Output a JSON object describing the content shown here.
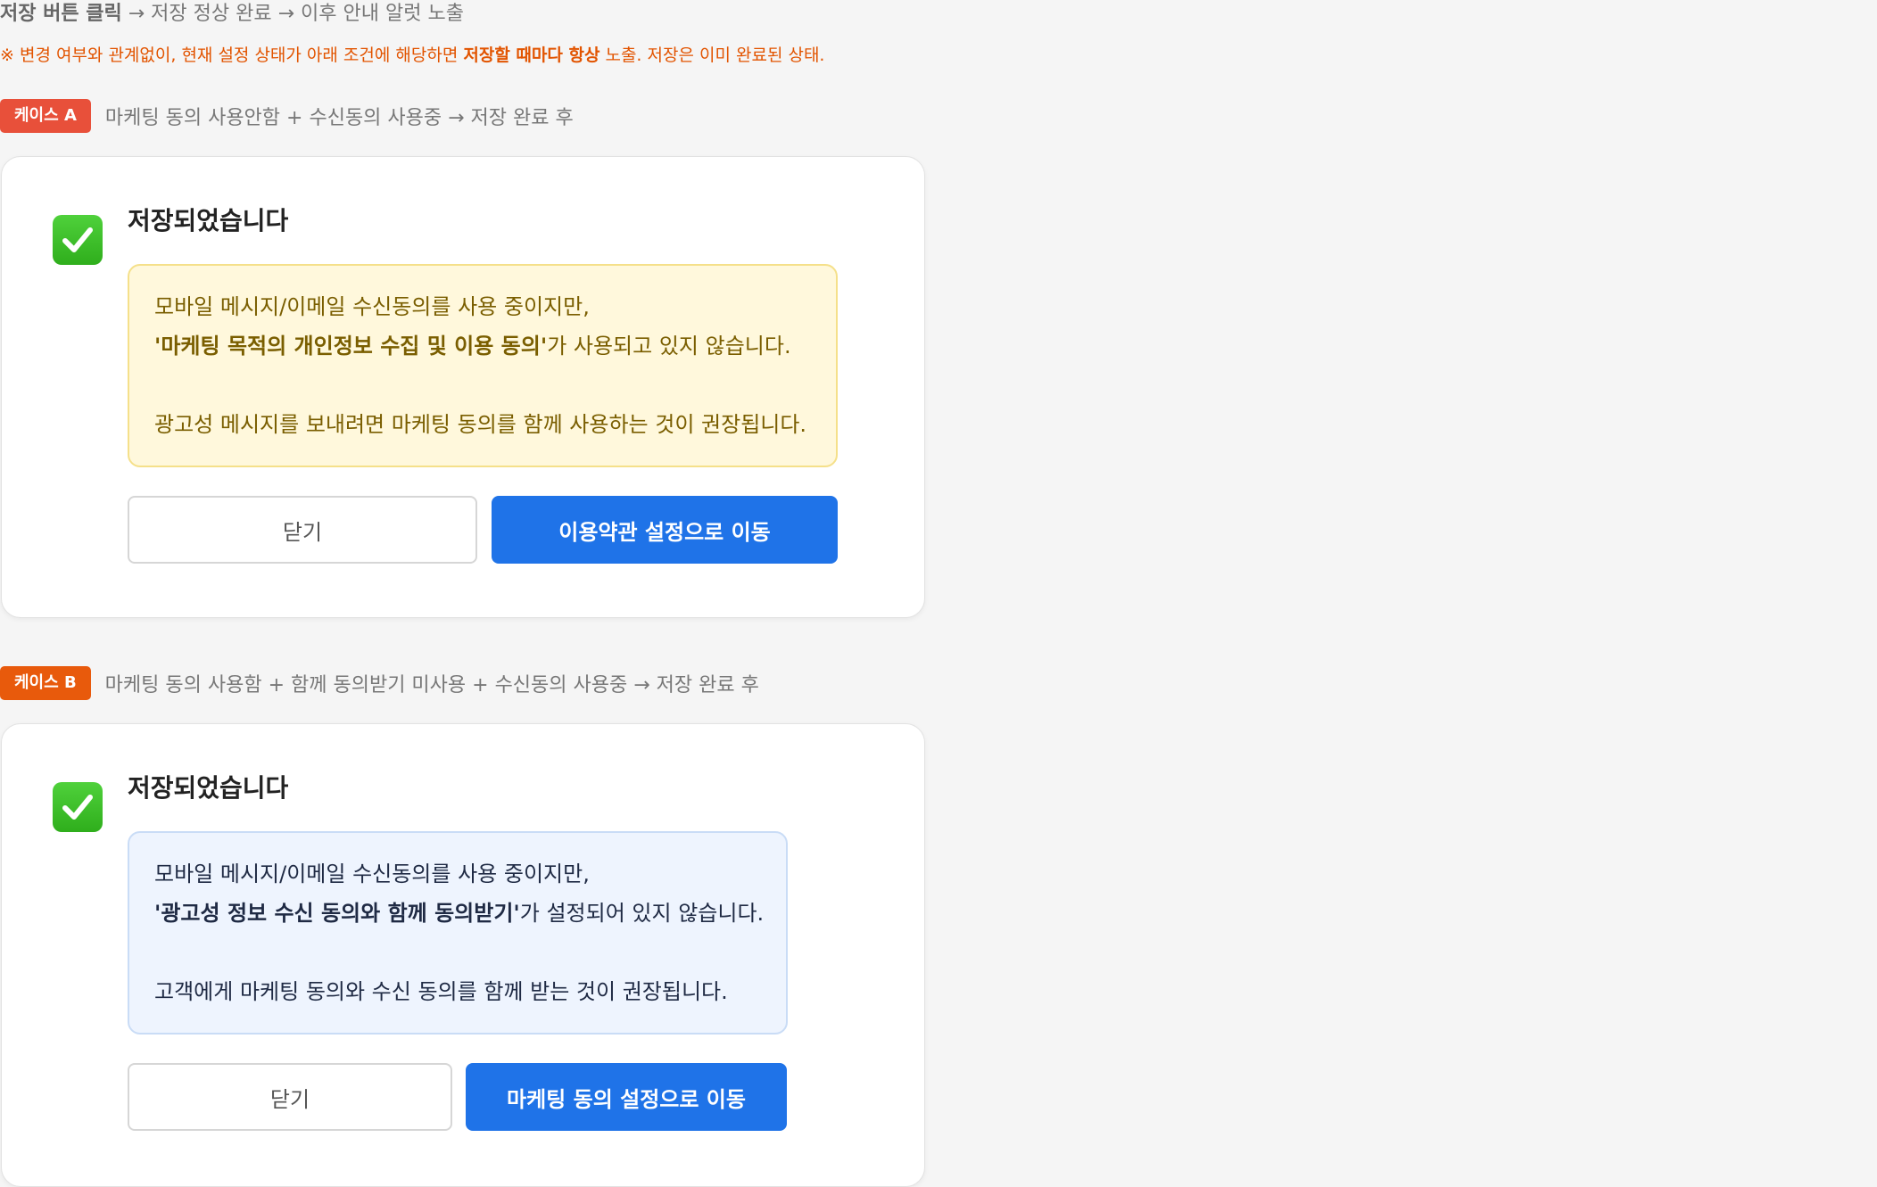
{
  "flow": {
    "step1": "저장 버튼 클릭",
    "rest": " → 저장 정상 완료 → 이후 안내 알럿 노출"
  },
  "note": {
    "prefix": "※ 변경 여부와 관계없이, 현재 설정 상태가 아래 조건에 해당하면 ",
    "emph": "저장할 때마다 항상",
    "suffix": " 노출. 저장은 이미 완료된 상태."
  },
  "case_a": {
    "badge": "케이스 A",
    "badge_color": "#e8503a",
    "desc": "마케팅 동의 사용안함 + 수신동의 사용중 → 저장 완료 후",
    "title": "저장되었습니다",
    "line1": "모바일 메시지/이메일 수신동의를 사용 중이지만,",
    "line2_bold": "'마케팅 목적의 개인정보 수집 및 이용 동의'",
    "line2_rest": "가 사용되고 있지 않습니다.",
    "line3": "광고성 메시지를 보내려면 마케팅 동의를 함께 사용하는 것이 권장됩니다.",
    "close_label": "닫기",
    "action_label": "이용약관 설정으로 이동"
  },
  "case_b": {
    "badge": "케이스 B",
    "badge_color": "#e85a0c",
    "desc": "마케팅 동의 사용함 + 함께 동의받기 미사용 + 수신동의 사용중 → 저장 완료 후",
    "title": "저장되었습니다",
    "line1": "모바일 메시지/이메일 수신동의를 사용 중이지만,",
    "line2_bold": "'광고성 정보 수신 동의와 함께 동의받기'",
    "line2_rest": "가 설정되어 있지 않습니다.",
    "line3": "고객에게 마케팅 동의와 수신 동의를 함께 받는 것이 권장됩니다.",
    "close_label": "닫기",
    "action_label": "마케팅 동의 설정으로 이동"
  },
  "icons": {
    "success": "check-box-icon"
  },
  "colors": {
    "primary": "#1f73e8",
    "note": "#e25400"
  }
}
